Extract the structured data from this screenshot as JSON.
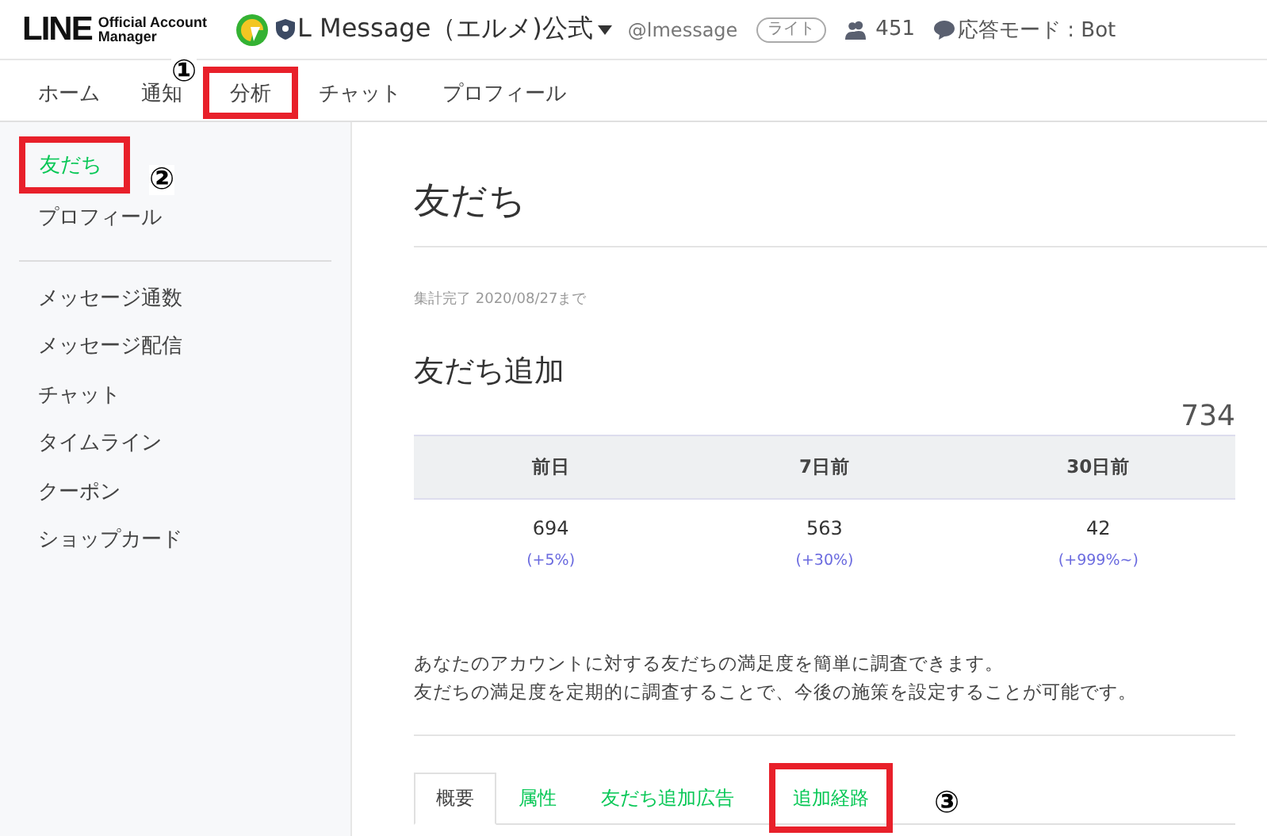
{
  "header": {
    "logo": "LINE",
    "logo_sub": [
      "Official Account",
      "Manager"
    ],
    "account_name": "L Message（エルメ)公式",
    "account_id": "@lmessage",
    "plan_badge": "ライト",
    "friends_count": "451",
    "response_mode": "応答モード : Bot"
  },
  "nav_tabs": [
    {
      "label": "ホーム",
      "selected": false,
      "highlighted": false
    },
    {
      "label": "通知",
      "selected": false,
      "highlighted": false
    },
    {
      "label": "分析",
      "selected": false,
      "highlighted": true,
      "callout": "①"
    },
    {
      "label": "チャット",
      "selected": false,
      "highlighted": false
    },
    {
      "label": "プロフィール",
      "selected": false,
      "highlighted": false
    }
  ],
  "sidebar": {
    "groups": [
      [
        {
          "label": "友だち",
          "selected": true,
          "highlighted": true,
          "callout": "②"
        },
        {
          "label": "プロフィール",
          "selected": false,
          "highlighted": false
        }
      ],
      [
        {
          "label": "メッセージ通数",
          "selected": false,
          "highlighted": false
        },
        {
          "label": "メッセージ配信",
          "selected": false,
          "highlighted": false
        },
        {
          "label": "チャット",
          "selected": false,
          "highlighted": false
        },
        {
          "label": "タイムライン",
          "selected": false,
          "highlighted": false
        },
        {
          "label": "クーポン",
          "selected": false,
          "highlighted": false
        },
        {
          "label": "ショップカード",
          "selected": false,
          "highlighted": false
        }
      ]
    ]
  },
  "main": {
    "title": "友だち",
    "updated": "集計完了 2020/08/27まで",
    "section_title": "友だち追加",
    "total": "734",
    "table": {
      "columns": [
        "前日",
        "7日前",
        "30日前"
      ],
      "values": [
        "694",
        "563",
        "42"
      ],
      "changes": [
        "(+5%)",
        "(+30%)",
        "(+999%~)"
      ]
    },
    "description": [
      "あなたのアカウントに対する友だちの満足度を簡単に調査できます。",
      "友だちの満足度を定期的に調査することで、今後の施策を設定することが可能です。"
    ],
    "sub_tabs": [
      {
        "label": "概要",
        "selected": true,
        "highlighted": false
      },
      {
        "label": "属性",
        "selected": false,
        "highlighted": false
      },
      {
        "label": "友だち追加広告",
        "selected": false,
        "highlighted": false
      },
      {
        "label": "追加経路",
        "selected": false,
        "highlighted": true,
        "callout": "③"
      }
    ]
  }
}
